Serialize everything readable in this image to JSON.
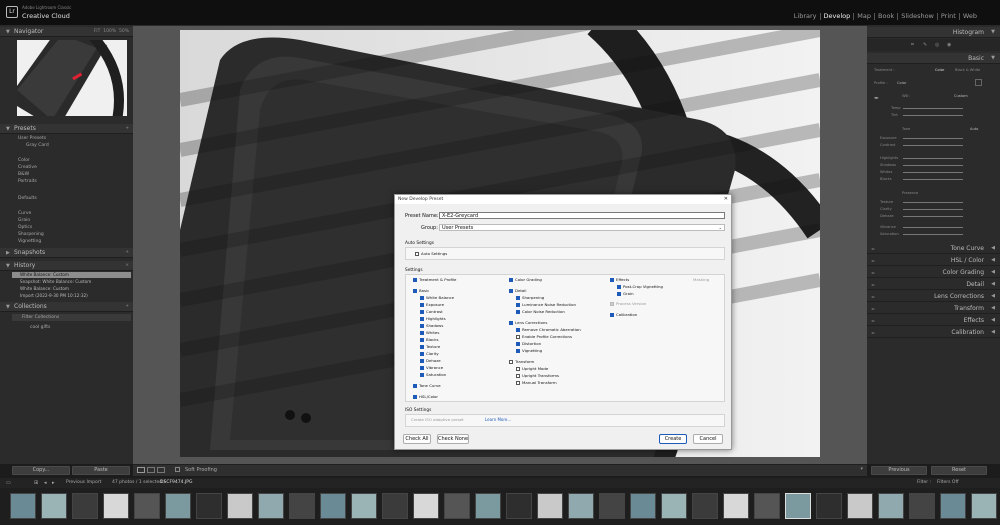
{
  "app": {
    "vendor": "Adobe Lightroom Classic",
    "name": "Creative Cloud"
  },
  "modules": [
    "Library",
    "Develop",
    "Map",
    "Book",
    "Slideshow",
    "Print",
    "Web"
  ],
  "active_module": "Develop",
  "left_panel": {
    "navigator": {
      "title": "Navigator",
      "zoom_opts": [
        "FIT",
        "100%",
        "50%"
      ]
    },
    "presets": {
      "title": "Presets",
      "items": [
        "User Presets",
        "Gray Card",
        "Color",
        "Creative",
        "B&W",
        "Portraits",
        "Defaults",
        "Curve",
        "Grain",
        "Optics",
        "Sharpening",
        "Vignetting"
      ]
    },
    "snapshots": {
      "title": "Snapshots"
    },
    "history": {
      "title": "History",
      "items": [
        "White Balance: Custom",
        "Snapshot: White Balance: Custom",
        "White Balance: Custom",
        "Import (2022-9-30 PM 10:12:32)"
      ]
    },
    "collections": {
      "title": "Collections",
      "items": [
        "Filter Collections",
        "cool gifts"
      ]
    },
    "copy_label": "Copy...",
    "paste_label": "Paste"
  },
  "right_panel": {
    "histogram": "Histogram",
    "basic": "Basic",
    "treatment": {
      "label": "Treatment :",
      "color": "Color",
      "bw": "Black & White"
    },
    "profile": {
      "label": "Profile :",
      "value": "Color"
    },
    "wb": {
      "label": "WB :",
      "value": "Custom",
      "temp": "Temp",
      "tint": "Tint"
    },
    "tone": {
      "label": "Tone",
      "auto": "Auto",
      "sliders": [
        "Exposure",
        "Contrast",
        "Highlights",
        "Shadows",
        "Whites",
        "Blacks"
      ]
    },
    "presence": {
      "label": "Presence",
      "sliders": [
        "Texture",
        "Clarity",
        "Dehaze",
        "Vibrance",
        "Saturation"
      ]
    },
    "sections": [
      "Tone Curve",
      "HSL / Color",
      "Color Grading",
      "Detail",
      "Lens Corrections",
      "Transform",
      "Effects",
      "Calibration"
    ],
    "previous_label": "Previous",
    "reset_label": "Reset"
  },
  "toolbar": {
    "soft_proofing": "Soft Proofing"
  },
  "filmstrip": {
    "source": "Previous Import",
    "info": "47 photos / 1 selected /",
    "file": "DSCF9474.JPG",
    "filter_label": "Filter :",
    "filters_off": "Filters Off"
  },
  "dialog": {
    "title": "New Develop Preset",
    "preset_name_label": "Preset Name:",
    "preset_name_value": "X-E2-Greycard",
    "group_label": "Group:",
    "group_value": "User Presets",
    "auto_settings_title": "Auto Settings",
    "auto_settings_cb": "Auto Settings",
    "settings_title": "Settings",
    "col1": {
      "treatment": "Treatment & Profile",
      "basic": "Basic",
      "basic_items": [
        "White Balance",
        "Exposure",
        "Contrast",
        "Highlights",
        "Shadows",
        "Whites",
        "Blacks",
        "Texture",
        "Clarity",
        "Dehaze",
        "Vibrance",
        "Saturation"
      ],
      "tone_curve": "Tone Curve",
      "hsl": "HSL/Color"
    },
    "col2": {
      "color_grading": "Color Grading",
      "detail": "Detail",
      "detail_items": [
        "Sharpening",
        "Luminance Noise Reduction",
        "Color Noise Reduction"
      ],
      "lens": "Lens Corrections",
      "lens_items": [
        "Remove Chromatic Aberration",
        "Enable Profile Corrections",
        "Distortion",
        "Vignetting"
      ],
      "transform": "Transform",
      "transform_items": [
        "Upright Mode",
        "Upright Transforms",
        "Manual Transform"
      ]
    },
    "col3": {
      "effects": "Effects",
      "masking": "Masking",
      "effects_items": [
        "Post-Crop Vignetting",
        "Grain"
      ],
      "process_version": "Process Version",
      "calibration": "Calibration"
    },
    "iso_title": "ISO Settings",
    "iso_cb": "Create ISO adaptive preset",
    "learn_more": "Learn More...",
    "check_all": "Check All",
    "check_none": "Check None",
    "create": "Create",
    "cancel": "Cancel"
  }
}
